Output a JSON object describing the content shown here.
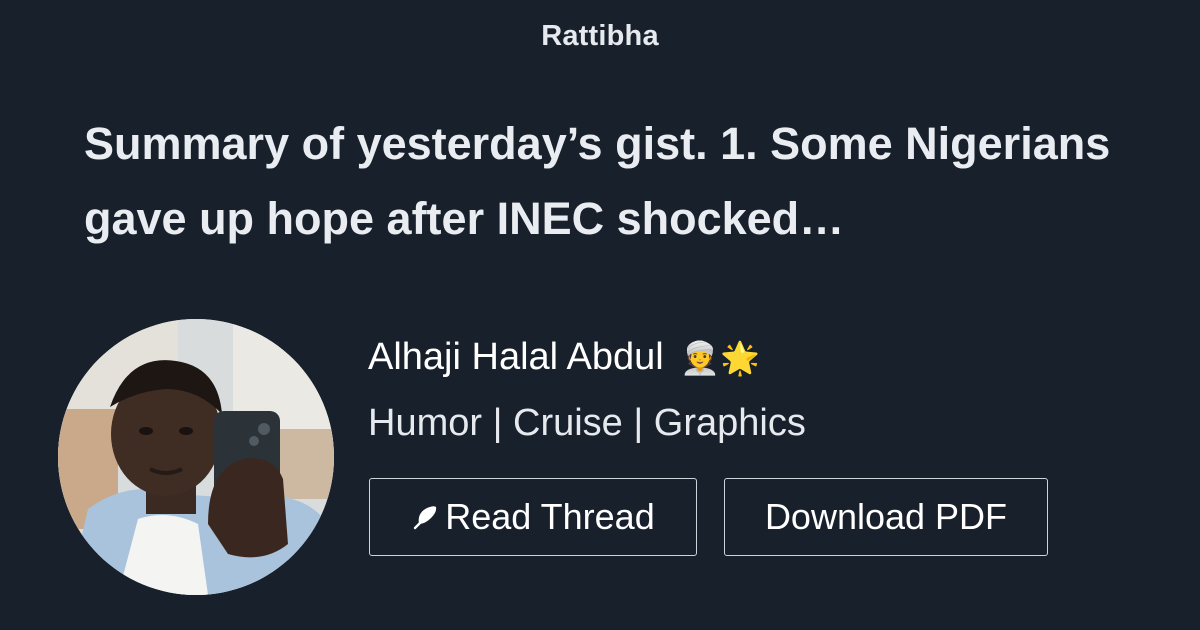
{
  "brand": {
    "name": "Rattibha"
  },
  "thread": {
    "title": "Summary of yesterday’s gist. 1. Some Nigerians gave up hope after INEC shocked…"
  },
  "author": {
    "name": "Alhaji Halal Abdul",
    "name_emoji": "👳🌟",
    "bio": "Humor | Cruise | Graphics"
  },
  "actions": {
    "read_thread_label": "Read Thread",
    "read_thread_icon": "feather-icon",
    "download_pdf_label": "Download PDF"
  },
  "colors": {
    "background": "#18202b",
    "text": "#ffffff",
    "button_border": "#cfd4da"
  }
}
